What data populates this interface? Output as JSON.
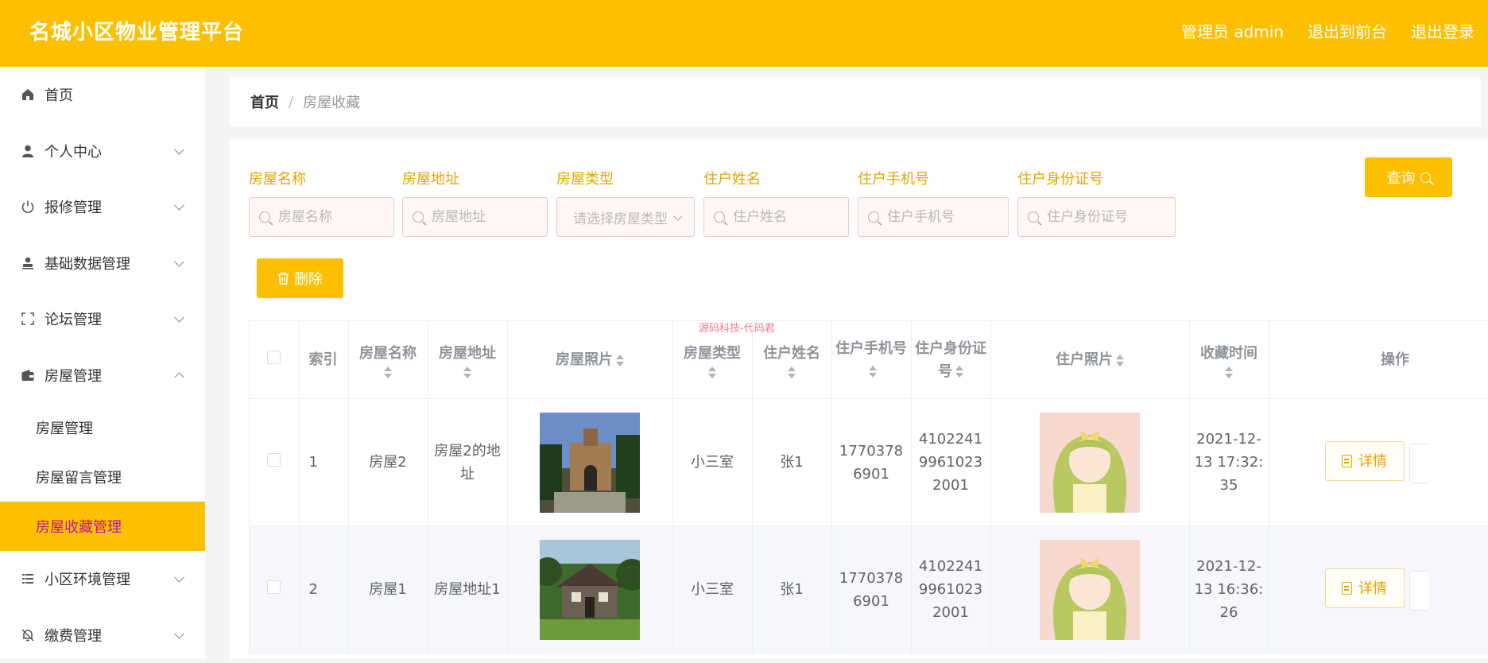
{
  "header": {
    "title": "名城小区物业管理平台",
    "admin": "管理员 admin",
    "to_front": "退出到前台",
    "logout": "退出登录"
  },
  "sidebar": {
    "items": [
      {
        "label": "首页",
        "icon": "home-icon"
      },
      {
        "label": "个人中心",
        "icon": "user-icon"
      },
      {
        "label": "报修管理",
        "icon": "power-icon"
      },
      {
        "label": "基础数据管理",
        "icon": "person-stand-icon"
      },
      {
        "label": "论坛管理",
        "icon": "frame-corners-icon"
      },
      {
        "label": "房屋管理",
        "icon": "wallet-icon"
      },
      {
        "label": "小区环境管理",
        "icon": "list-icon"
      },
      {
        "label": "缴费管理",
        "icon": "bell-off-icon"
      }
    ],
    "sub_items": [
      "房屋管理",
      "房屋留言管理",
      "房屋收藏管理"
    ]
  },
  "breadcrumb": {
    "home": "首页",
    "separator": "/",
    "current": "房屋收藏"
  },
  "filters": {
    "house_name": {
      "label": "房屋名称",
      "placeholder": "房屋名称"
    },
    "house_address": {
      "label": "房屋地址",
      "placeholder": "房屋地址"
    },
    "house_type": {
      "label": "房屋类型",
      "placeholder": "请选择房屋类型"
    },
    "resident_name": {
      "label": "住户姓名",
      "placeholder": "住户姓名"
    },
    "resident_phone": {
      "label": "住户手机号",
      "placeholder": "住户手机号"
    },
    "resident_id": {
      "label": "住户身份证号",
      "placeholder": "住户身份证号"
    },
    "query_label": "查询"
  },
  "toolbar": {
    "delete_label": "删除"
  },
  "watermark": "源码科技-代码君",
  "table": {
    "headers": {
      "index": "索引",
      "house_name": "房屋名称",
      "house_address": "房屋地址",
      "house_photo": "房屋照片",
      "house_type": "房屋类型",
      "resident_name": "住户姓名",
      "resident_phone": "住户手机号",
      "resident_id": "住户身份证号",
      "resident_photo": "住户照片",
      "fav_time": "收藏时间",
      "actions": "操作"
    },
    "rows": [
      {
        "index": "1",
        "house_name": "房屋2",
        "house_address": "房屋2的地址",
        "house_type": "小三室",
        "resident_name": "张1",
        "resident_phone": "17703786901",
        "resident_id": "410224199610232001",
        "fav_time": "2021-12-13 17:32:35",
        "detail_label": "详情"
      },
      {
        "index": "2",
        "house_name": "房屋1",
        "house_address": "房屋地址1",
        "house_type": "小三室",
        "resident_name": "张1",
        "resident_phone": "17703786901",
        "resident_id": "410224199610232001",
        "fav_time": "2021-12-13 16:36:26",
        "detail_label": "详情"
      }
    ]
  },
  "colors": {
    "brand": "#fcc000",
    "active_text": "#b5179e",
    "label": "#e6a400"
  }
}
